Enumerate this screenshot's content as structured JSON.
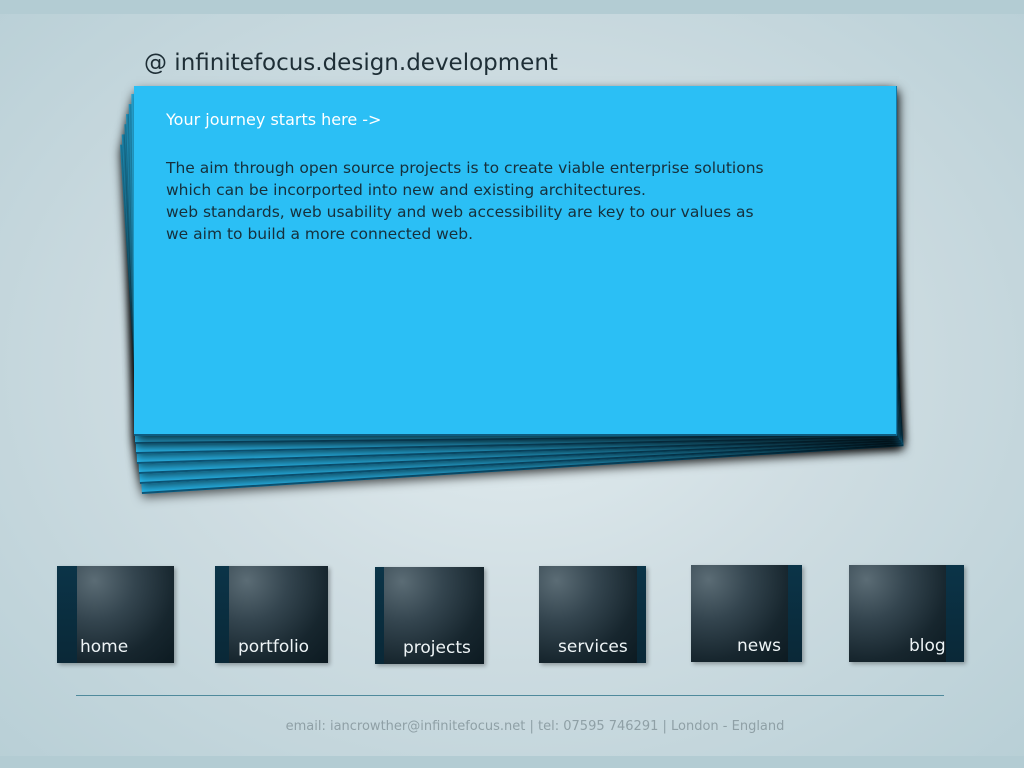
{
  "header": {
    "site_title": "@ infinitefocus.design.development"
  },
  "card": {
    "tagline": "Your journey starts here ->",
    "paragraph_1": "The aim through open source projects is to create viable enterprise solutions which can be incorported into new and existing architectures.",
    "paragraph_2": "web standards, web usability and web accessibility are key to our values as we aim to build a more connected web."
  },
  "nav": {
    "items": [
      {
        "label": "home"
      },
      {
        "label": "portfolio"
      },
      {
        "label": "projects"
      },
      {
        "label": "services"
      },
      {
        "label": "news"
      },
      {
        "label": "blog"
      }
    ]
  },
  "footer": {
    "contact": "email: iancrowther@infinitefocus.net | tel: 07595 746291 | London - England"
  },
  "colors": {
    "card_blue": "#2bbff5",
    "nav_box_dark": "#17262e",
    "nav_box_side": "#0b3448",
    "background": "#cfdde2"
  }
}
